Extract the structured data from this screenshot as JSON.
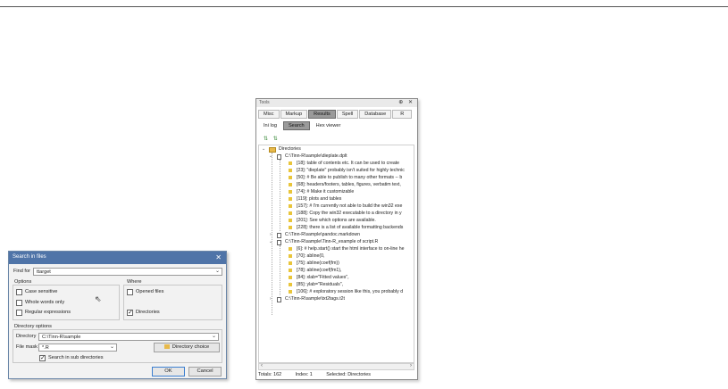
{
  "dialog": {
    "title": "Search in files",
    "close": "✕",
    "find_label": "Find for",
    "find_value": "ttarget",
    "options_label": "Options",
    "where_label": "Where",
    "case_sensitive": "Case sensitive",
    "whole_words": "Whole words only",
    "regex": "Regular expressions",
    "opened_files": "Opened files",
    "directories": "Directories",
    "directory_options": "Directory options",
    "directory_label": "Directory",
    "directory_value": "C:\\Tinn-R\\sample",
    "filemask_label": "File mask",
    "filemask_value": "*.R",
    "directory_choice": "Directory choice",
    "search_sub": "Search in sub directories",
    "ok": "OK",
    "cancel": "Cancel"
  },
  "tools": {
    "title": "Tools",
    "title_controls": "⊕ ✕",
    "tabs": [
      "Misc",
      "Markup",
      "Results",
      "Spell",
      "Database",
      "R"
    ],
    "subtabs": [
      "Ini log",
      "Search",
      "Hex viewer"
    ],
    "root": "Directories",
    "files": [
      {
        "path": "C:\\Tinn-R\\sample\\dieplate.dplt",
        "items": [
          "[18]: table of contents etc.  It can be used to create",
          "[23]: \"dieplate\" probably isn't suited for highly technic",
          "[50]: # Be able to publish to many other formats -- b",
          "[68]: headers/footers, tables, figures, verbatim text,",
          "[74]: # Make it customizable",
          "[119]: plots and tables",
          "[157]: # I'm currently not able to build the win32 exe",
          "[188]: Copy the win32 executable to a directory in y",
          "[201]: See which options are available.",
          "[228]: there is a list of available formatting backends"
        ]
      },
      {
        "path": "C:\\Tinn-R\\sample\\pandoc.markdown",
        "items": []
      },
      {
        "path": "C:\\Tinn-R\\sample\\Tinn-R_example of script.R",
        "items": [
          "[6]: # help.start() start the html interface to on-line he",
          "[70]: abline(0,",
          "[75]: abline(coef(fm))",
          "[78]: abline(coef(fm1),",
          "[84]: xlab=\"Fitted values\",",
          "[85]: ylab=\"Residuals\",",
          "[106]: # exploratory session like this, you probably d"
        ]
      },
      {
        "path": "C:\\Tinn-R\\sample\\txt2tags.t2t",
        "items": []
      }
    ],
    "status_totals": "Totals: 162",
    "status_index": "Index: 1",
    "status_selected": "Selected: Directories"
  }
}
